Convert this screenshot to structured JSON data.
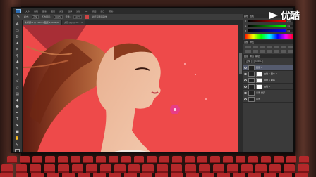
{
  "app": {
    "menu": [
      "文件",
      "编辑",
      "图像",
      "图层",
      "类型",
      "选择",
      "滤镜",
      "3D",
      "视图",
      "窗口",
      "帮助"
    ],
    "options": {
      "mode_label": "模式:",
      "mode_value": "正常",
      "opacity_label": "不透明度:",
      "opacity_value": "100%",
      "flow_label": "流量:",
      "flow_value": "100%",
      "sample_label": "对所有图层取样"
    },
    "tabs": [
      {
        "label": "未标题-1 @ 100% (图层 1, RGB/8)"
      },
      {
        "label": "女孩.jpg @ 66.7%"
      }
    ]
  },
  "panels": {
    "color_tabs": [
      "颜色",
      "色板"
    ],
    "color_values": {
      "r": "237",
      "g": "74",
      "b": "74"
    },
    "adjust_tabs": [
      "调整",
      "样式"
    ],
    "layers_tabs": [
      "图层",
      "通道",
      "路径"
    ],
    "blend_mode": "正常",
    "opacity": "100%",
    "layers": [
      {
        "name": "图层 1",
        "selected": true
      },
      {
        "name": "曲线 1 副本 2"
      },
      {
        "name": "曲线 1 副本"
      },
      {
        "name": "曲线 1"
      },
      {
        "name": "背景 拷贝"
      },
      {
        "name": "背景"
      }
    ]
  },
  "logo": {
    "text": "优酷"
  },
  "colors": {
    "canvas_bg": "#ee4a4a",
    "seat": "#b3282a",
    "accent_pink": "#e83c86"
  }
}
